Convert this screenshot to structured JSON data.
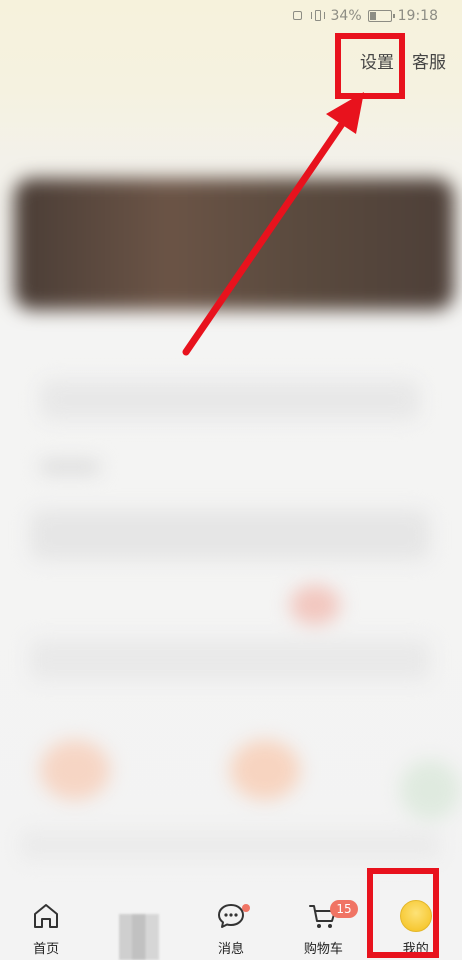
{
  "status_bar": {
    "battery_text": "34%",
    "battery_level": 0.34,
    "time": "19:18"
  },
  "header": {
    "settings_label": "设置",
    "service_label": "客服"
  },
  "tab_bar": {
    "tabs": [
      {
        "label": "首页",
        "icon": "home-icon"
      },
      {
        "label": "",
        "icon": "pixelated-tab-icon"
      },
      {
        "label": "消息",
        "icon": "message-icon"
      },
      {
        "label": "购物车",
        "icon": "cart-icon",
        "badge": "15"
      },
      {
        "label": "我的",
        "icon": "avatar-icon"
      }
    ]
  },
  "annotation": {
    "color": "#e8121d"
  },
  "colors": {
    "badge": "#f07464",
    "text": "#222222"
  }
}
